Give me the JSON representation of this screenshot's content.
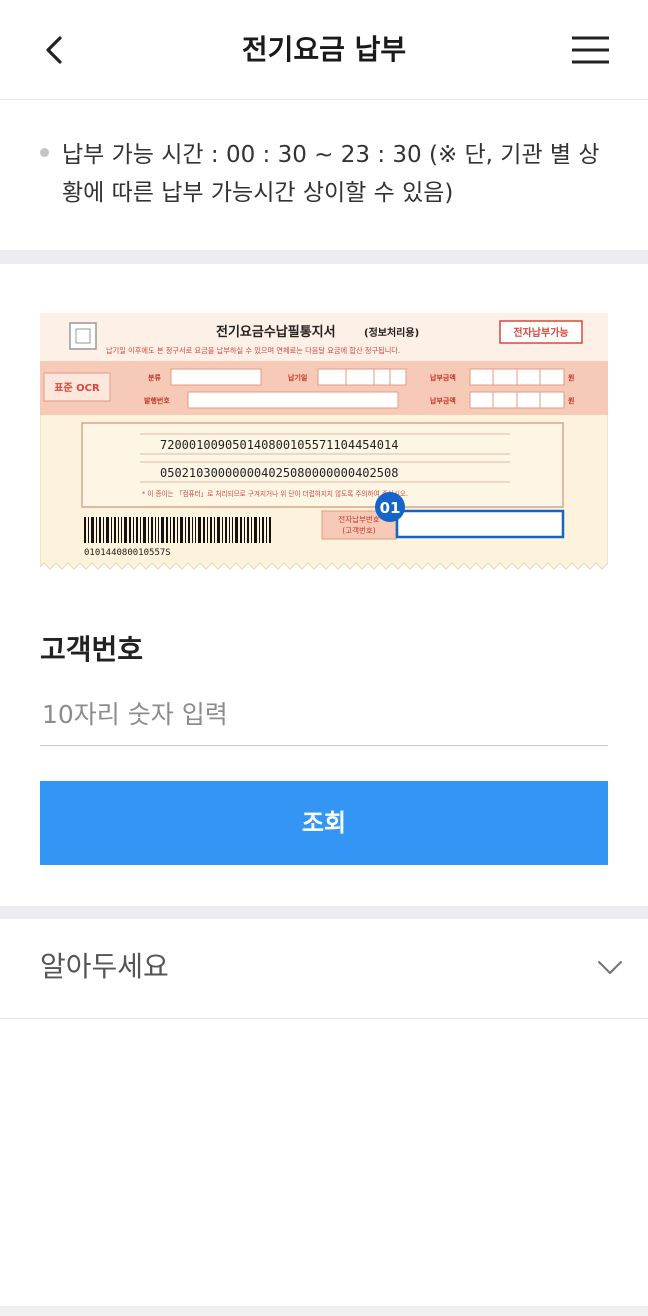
{
  "header": {
    "title": "전기요금 납부",
    "back_icon": "chevron-left-icon",
    "menu_icon": "hamburger-menu-icon"
  },
  "notice": {
    "text": "납부 가능 시간 : 00 : 30 ~ 23 : 30 (※ 단, 기관 별 상황에 따른 납부 가능시간 상이할 수 있음)"
  },
  "bill": {
    "title": "전기요금수납필통지서",
    "title_suffix": "(정보처리용)",
    "badge": "전자납부가능",
    "warning": "납기일 이후에도 본 청구서로 요금을 납부하실 수 있으며 연체료는 다음달 요금에 합산 청구됩니다.",
    "ocr_label": "표준 OCR",
    "label_category": "분류",
    "label_due": "납기일",
    "label_amount_1": "납부금액",
    "label_issue_no": "발행번호",
    "label_amount_2": "납부금액",
    "unit_won_1": "원",
    "unit_won_2": "원",
    "code_line_1": "720001009050140800105571104454014",
    "code_line_2": "050210300000004025080000000402508",
    "footnote": "* 이 종이는 「컴퓨터」로 처리되므로 구겨지거나 위 단이 더럽혀지지 않도록 주의하여 주십시오.",
    "marker": "01",
    "epay_label_1": "전자납부번호",
    "epay_label_2": "(고객번호)",
    "barcode_number": "010144080010557S"
  },
  "form": {
    "label": "고객번호",
    "placeholder": "10자리 숫자 입력",
    "value": ""
  },
  "search_button": {
    "label": "조회"
  },
  "accordion": {
    "label": "알아두세요",
    "icon": "chevron-down-icon"
  },
  "colors": {
    "primary": "#3396f4",
    "bill_background": "#fdf3dc",
    "bill_accent": "#f7c9b7",
    "bill_red": "#d9473b",
    "marker_blue": "#1565c8"
  }
}
